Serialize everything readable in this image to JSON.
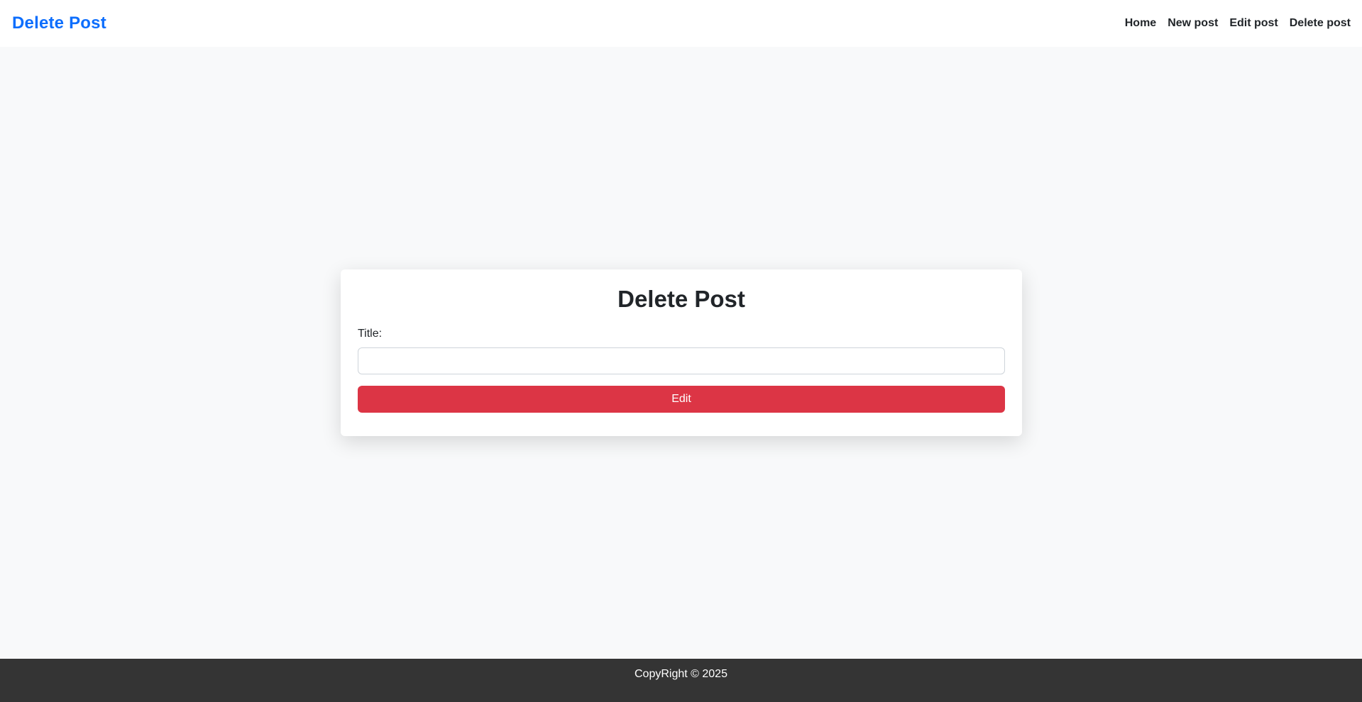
{
  "navbar": {
    "brand": "Delete Post",
    "links": [
      {
        "label": "Home"
      },
      {
        "label": "New post"
      },
      {
        "label": "Edit post"
      },
      {
        "label": "Delete post"
      }
    ]
  },
  "card": {
    "title": "Delete Post",
    "title_label": "Title:",
    "title_value": "",
    "title_placeholder": "",
    "submit_label": "Edit"
  },
  "footer": {
    "text": "CopyRight © 2025"
  },
  "colors": {
    "brand": "#0d6efd",
    "danger": "#dc3545",
    "footer_bg": "#343434",
    "page_bg": "#f8f9fa"
  }
}
